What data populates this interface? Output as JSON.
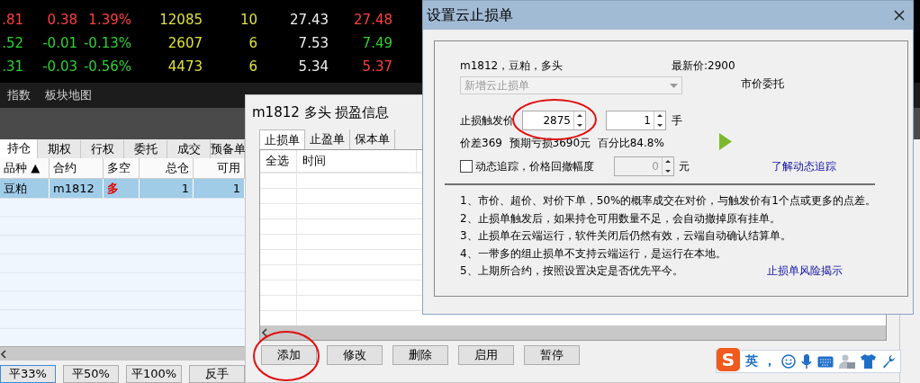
{
  "quotes": {
    "rows": [
      {
        "cells": [
          {
            "text": ".81",
            "color": "#ff4040"
          },
          {
            "text": "0.38",
            "color": "#ff4040"
          },
          {
            "text": "1.39%",
            "color": "#ff4040"
          },
          {
            "text": "12085",
            "color": "#e0e040"
          },
          {
            "text": "10",
            "color": "#e0e040"
          },
          {
            "text": "27.43",
            "color": "#f0f0f0"
          },
          {
            "text": "27.48",
            "color": "#ff4040"
          }
        ]
      },
      {
        "cells": [
          {
            "text": ".52",
            "color": "#30d030"
          },
          {
            "text": "-0.01",
            "color": "#30d030"
          },
          {
            "text": "-0.13%",
            "color": "#30d030"
          },
          {
            "text": "2607",
            "color": "#e0e040"
          },
          {
            "text": "6",
            "color": "#e0e040"
          },
          {
            "text": "7.53",
            "color": "#f0f0f0"
          },
          {
            "text": "7.49",
            "color": "#30d030"
          }
        ]
      },
      {
        "cells": [
          {
            "text": ".31",
            "color": "#30d030"
          },
          {
            "text": "-0.03",
            "color": "#30d030"
          },
          {
            "text": "-0.56%",
            "color": "#30d030"
          },
          {
            "text": "4473",
            "color": "#e0e040"
          },
          {
            "text": "6",
            "color": "#e0e040"
          },
          {
            "text": "5.34",
            "color": "#f0f0f0"
          },
          {
            "text": "5.37",
            "color": "#ff4040"
          }
        ]
      }
    ]
  },
  "market_tabs": [
    "指数",
    "板块地图"
  ],
  "positions": {
    "tabs": [
      {
        "label": "持仓",
        "selected": true
      },
      {
        "label": "期权",
        "selected": false
      },
      {
        "label": "行权",
        "selected": false
      },
      {
        "label": "委托",
        "selected": false
      },
      {
        "label": "成交",
        "selected": false
      },
      {
        "label": "预备单",
        "selected": false
      }
    ],
    "columns": [
      "品种 ▲",
      "合约",
      "多空",
      "总仓",
      "可用"
    ],
    "rows": [
      {
        "selected": true,
        "cells": [
          {
            "text": "豆粕"
          },
          {
            "text": "m1812"
          },
          {
            "text": "多",
            "color": "#e00000"
          },
          {
            "text": "1"
          },
          {
            "text": "1"
          }
        ]
      }
    ],
    "buttons": [
      "平33%",
      "平50%",
      "平100%",
      "反手"
    ]
  },
  "order_window": {
    "title": "m1812 多头 损盈信息",
    "tabs": [
      {
        "label": "止损单",
        "selected": true
      },
      {
        "label": "止盈单",
        "selected": false
      },
      {
        "label": "保本单",
        "selected": false
      }
    ],
    "columns": [
      "全选",
      "时间"
    ],
    "buttons": [
      {
        "label": "添加",
        "circled": true
      },
      {
        "label": "修改",
        "circled": false
      },
      {
        "label": "删除",
        "circled": false
      },
      {
        "label": "启用",
        "circled": false
      },
      {
        "label": "暂停",
        "circled": false
      }
    ]
  },
  "dialog": {
    "title": "设置云止损单",
    "info": "m1812，豆粕，多头",
    "latest": "最新价:2900",
    "order_type": {
      "value": "新增云止损单",
      "disabled": true
    },
    "price_mode": "市价委托",
    "trigger": {
      "label": "止损触发价",
      "value": "2875",
      "circled": true
    },
    "quantity": {
      "value": "1",
      "unit": "手"
    },
    "estimate": "价差369  预期亏损3690元  百分比84.8%",
    "trailing": {
      "label": "动态追踪，价格回撤幅度",
      "checked": false,
      "value": "0",
      "unit": "元",
      "disabled": true
    },
    "trailing_link": "了解动态追踪",
    "notes": [
      "1、市价、超价、对价下单，50%的概率成交在对价，与触发价有1个点或更多的点差。",
      "2、止损单触发后，如果持仓可用数量不足，会自动撤掉原有挂单。",
      "3、止损单在云端运行，软件关闭后仍然有效，云端自动确认结算单。",
      "4、一带多的组止损单不支持云端运行，是运行在本地。",
      "5、上期所合约，按照设置决定是否优先平今。"
    ],
    "risk_link": "止损单风险揭示"
  },
  "ime_bar": {
    "logo": "S",
    "mode": "英",
    "punct": "，"
  }
}
